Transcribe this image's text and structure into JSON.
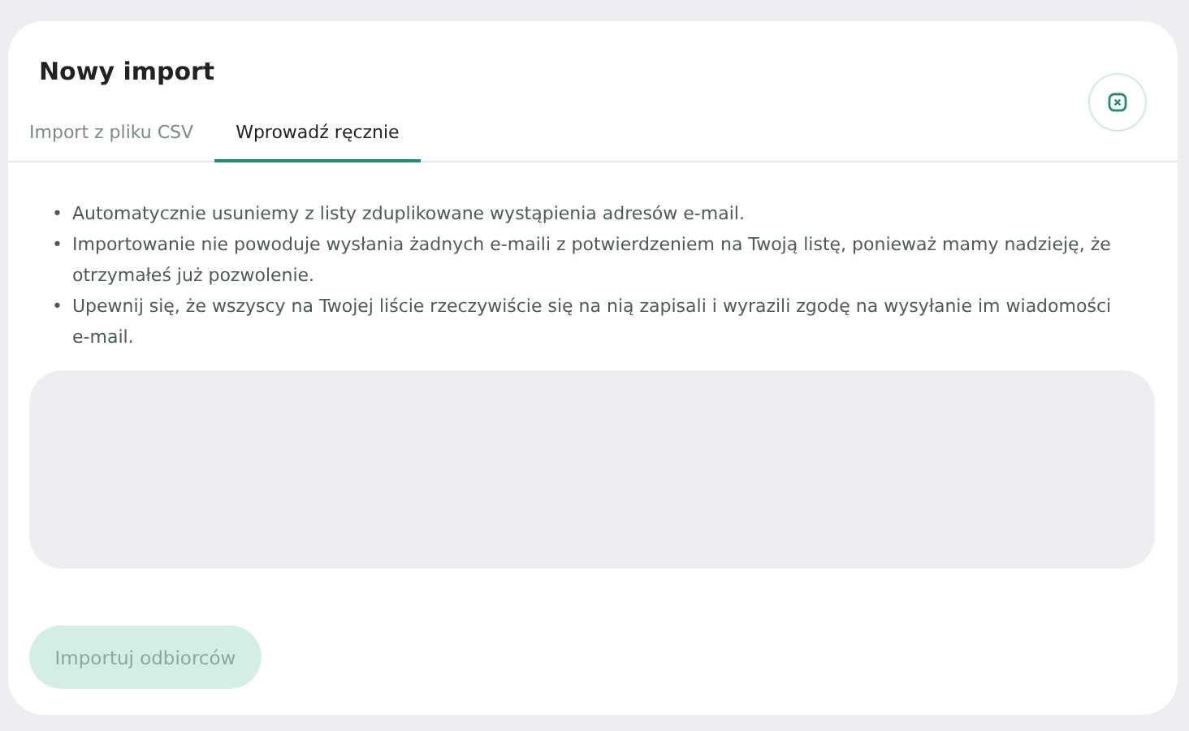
{
  "dialog": {
    "title": "Nowy import"
  },
  "tabs": [
    {
      "label": "Import z pliku CSV",
      "selected": false
    },
    {
      "label": "Wprowadź ręcznie",
      "selected": true
    }
  ],
  "notes": [
    {
      "marker": "•",
      "text": "Automatycznie usuniemy z listy zduplikowane wystąpienia adresów e-mail."
    },
    {
      "marker": "•",
      "text": "Importowanie nie powoduje wysłania żadnych e-maili z potwierdzeniem na Twoją listę, ponieważ mamy nadzieję, że otrzymałeś już pozwolenie."
    },
    {
      "marker": "•",
      "text": "Upewnij się, że wszyscy na Twojej liście rzeczywiście się na nią zapisali i wyrazili zgodę na wysyłanie im wiadomości e-mail."
    }
  ],
  "submit": {
    "label": "Importuj odbiorców",
    "disabled": true
  }
}
